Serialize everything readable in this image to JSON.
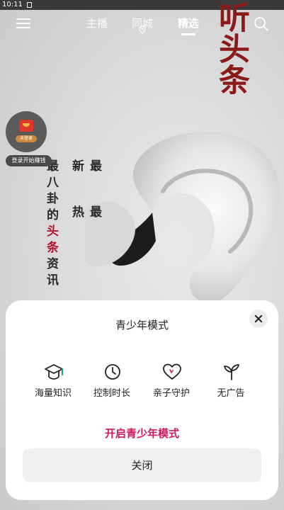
{
  "status_bar": {
    "time": "10:11"
  },
  "nav": {
    "tabs": [
      {
        "label": "主播",
        "active": false
      },
      {
        "label": "同城",
        "active": false
      },
      {
        "label": "精选",
        "active": true
      }
    ]
  },
  "banner": {
    "title": "听头条",
    "column_left": "最八卦的头条资讯",
    "column_left_highlight": "头条",
    "column_right_a": "最新",
    "column_right_b": "最热"
  },
  "float_ad": {
    "badge": "未登录",
    "label": "登录开始赚钱"
  },
  "sheet": {
    "title": "青少年模式",
    "features": [
      {
        "label": "海量知识",
        "icon": "graduation-cap-icon"
      },
      {
        "label": "控制时长",
        "icon": "clock-icon"
      },
      {
        "label": "亲子守护",
        "icon": "heart-icon"
      },
      {
        "label": "无广告",
        "icon": "sprout-icon"
      }
    ],
    "enable_label": "开启青少年模式",
    "close_label": "关闭"
  },
  "colors": {
    "accent": "#d0185f",
    "title_red": "#8b1a1a"
  }
}
